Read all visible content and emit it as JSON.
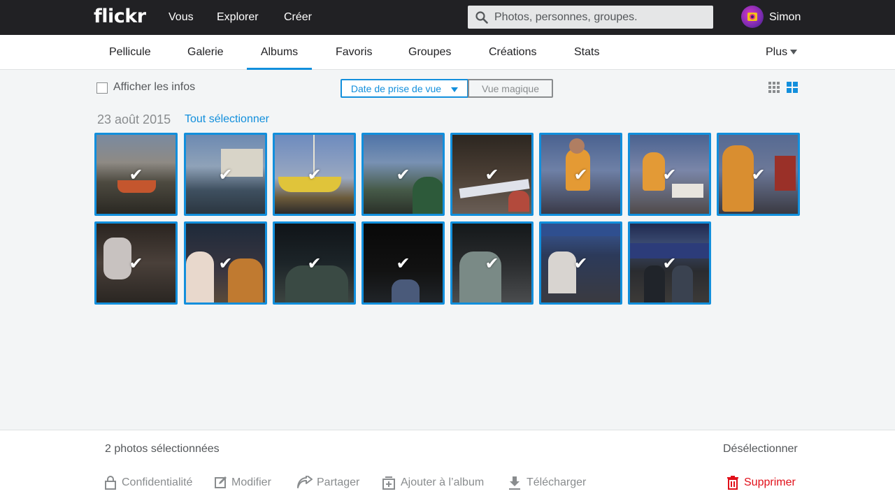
{
  "header": {
    "logo": "flickr",
    "nav": [
      {
        "label": "Vous"
      },
      {
        "label": "Explorer"
      },
      {
        "label": "Créer"
      }
    ],
    "search_placeholder": "Photos, personnes, groupes.",
    "username": "Simon"
  },
  "subnav": {
    "tabs": [
      {
        "label": "Pellicule"
      },
      {
        "label": "Galerie"
      },
      {
        "label": "Albums",
        "active": true
      },
      {
        "label": "Favoris"
      },
      {
        "label": "Groupes"
      },
      {
        "label": "Créations"
      },
      {
        "label": "Stats"
      }
    ],
    "more_label": "Plus"
  },
  "toolbar": {
    "show_info_label": "Afficher les infos",
    "show_info_checked": false,
    "sort_selected": "Date de prise de vue",
    "sort_alt": "Vue magique",
    "view_mode": "large-grid"
  },
  "group": {
    "date": "23 août 2015",
    "select_all": "Tout sélectionner",
    "photo_count": 15,
    "all_selected": true
  },
  "bottom": {
    "selection_count": "2 photos sélectionnées",
    "deselect": "Désélectionner",
    "actions": {
      "privacy": "Confidentialité",
      "edit": "Modifier",
      "share": "Partager",
      "add_album": "Ajouter à l’album",
      "download": "Télécharger",
      "delete": "Supprimer"
    }
  },
  "colors": {
    "accent": "#128fdc",
    "topbar": "#212124",
    "danger": "#e1101a"
  }
}
